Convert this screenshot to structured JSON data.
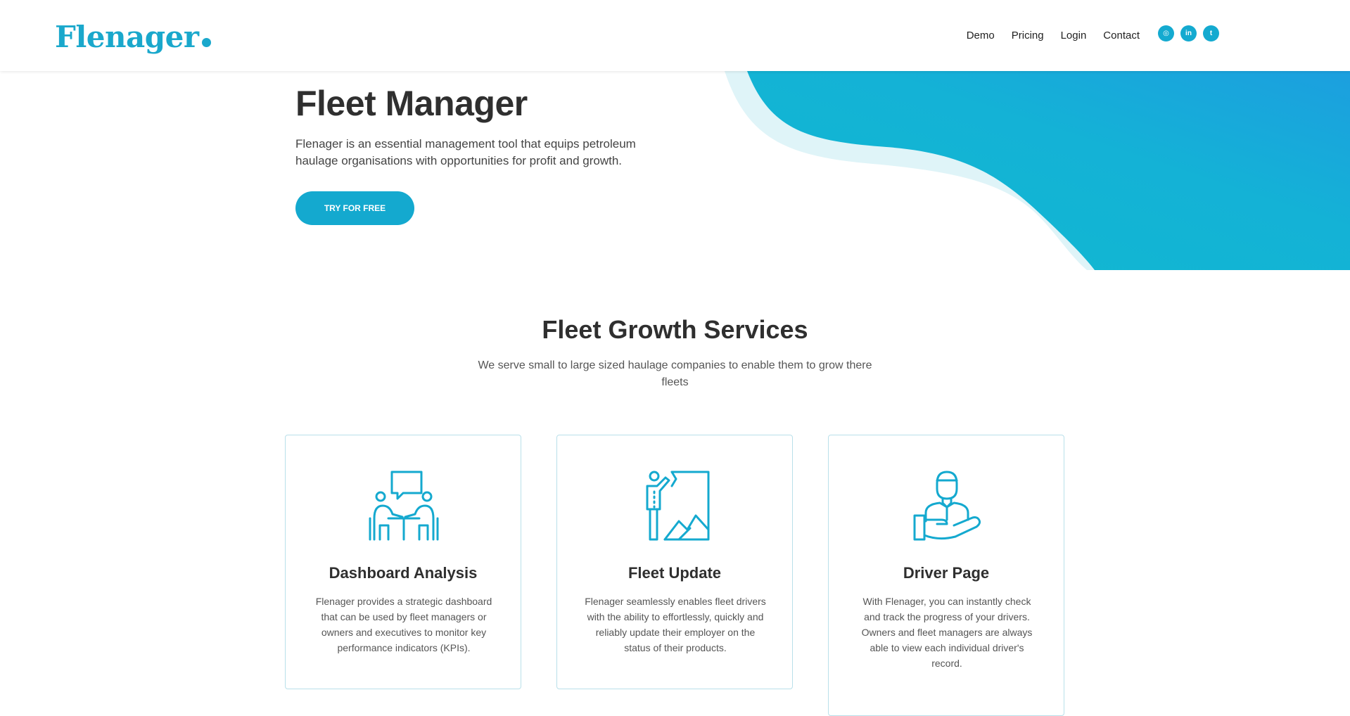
{
  "header": {
    "logo": "Flenager",
    "nav": [
      "Demo",
      "Pricing",
      "Login",
      "Contact"
    ],
    "social_icons": [
      "instagram-icon",
      "linkedin-icon",
      "twitter-icon"
    ],
    "social_glyphs": [
      "◎",
      "in",
      "t"
    ]
  },
  "hero": {
    "title": "Fleet Manager",
    "description": "Flenager is an essential management tool that equips petroleum haulage organisations with opportunities for profit and growth.",
    "cta": "TRY FOR FREE"
  },
  "services": {
    "title": "Fleet Growth Services",
    "subtitle": "We serve small to large sized haulage companies to enable them to grow there fleets",
    "cards": [
      {
        "icon": "meeting-icon",
        "title": "Dashboard Analysis",
        "text": "Flenager provides a strategic dashboard that can be used by fleet managers or owners and executives to monitor key performance indicators (KPIs)."
      },
      {
        "icon": "presentation-icon",
        "title": "Fleet Update",
        "text": "Flenager seamlessly enables fleet drivers with the ability to effortlessly, quickly and reliably update their employer on the status of their products."
      },
      {
        "icon": "driver-hand-icon",
        "title": "Driver Page",
        "text": "With Flenager, you can instantly check and track the progress of your drivers. Owners and fleet managers are always able to view each individual driver's record."
      }
    ]
  },
  "colors": {
    "brand": "#1aa8cc",
    "wave_light": "#dff4f8",
    "wave_main": "#13b4d3",
    "wave_dark": "#1aa0dc",
    "text_dark": "#2f2f2f"
  }
}
